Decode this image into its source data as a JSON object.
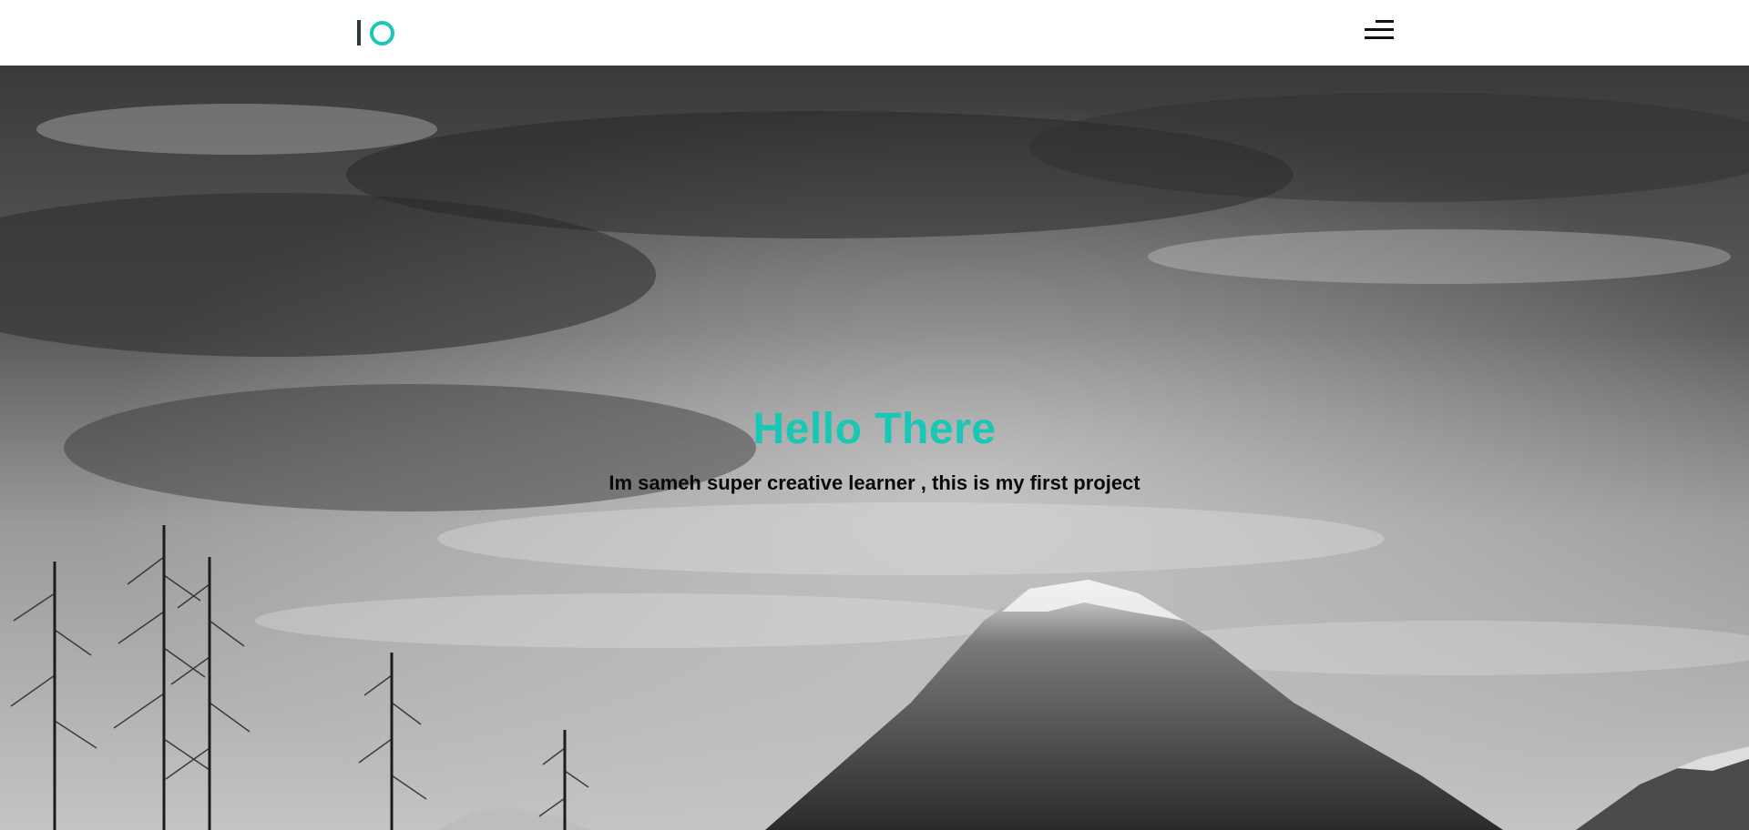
{
  "header": {
    "logo_icon": "io-logo",
    "menu_icon": "hamburger-menu-icon"
  },
  "hero": {
    "background": "black-and-white mountain with trees and cloudy sky",
    "title": "Hello There",
    "subtitle": "Im sameh super creative learner , this is my first project"
  },
  "colors": {
    "accent": "#19c7b5",
    "header_bg": "#ffffff",
    "subtitle_text": "#0a0a0a",
    "logo_bar": "#2b3a40"
  }
}
